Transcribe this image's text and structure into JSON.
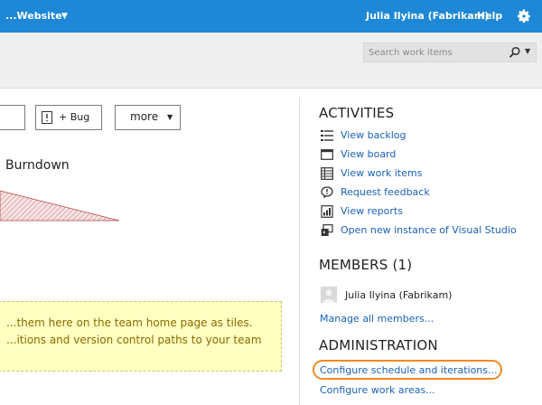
{
  "topbar": {
    "project": "...Website",
    "user": "Julia Ilyina (Fabrikam)",
    "help": "Help",
    "settings_icon": "gear-icon"
  },
  "search": {
    "placeholder": "Search work items"
  },
  "toolbar": {
    "bug_label": "+ Bug",
    "more_label": "more"
  },
  "burndown": {
    "title": "Burndown"
  },
  "tile_notice": {
    "line1": "...them here on the team home page as tiles.",
    "line2": "...itions and version control paths to your team"
  },
  "activities": {
    "title": "ACTIVITIES",
    "items": [
      {
        "label": "View backlog",
        "icon": "backlog-list-icon"
      },
      {
        "label": "View board",
        "icon": "board-icon"
      },
      {
        "label": "View work items",
        "icon": "work-items-icon"
      },
      {
        "label": "Request feedback",
        "icon": "feedback-icon"
      },
      {
        "label": "View reports",
        "icon": "reports-icon"
      },
      {
        "label": "Open new instance of Visual Studio",
        "icon": "visual-studio-icon"
      }
    ]
  },
  "members": {
    "title": "MEMBERS (1)",
    "list": [
      {
        "name": "Julia Ilyina (Fabrikam)"
      }
    ],
    "manage_link": "Manage all members..."
  },
  "administration": {
    "title": "ADMINISTRATION",
    "configure_schedule": "Configure schedule and iterations...",
    "configure_work_areas": "Configure work areas..."
  },
  "colors": {
    "topbar": "#1e88d6",
    "link": "#1a62b8",
    "highlight": "#f08a24",
    "tile_bg": "#ffffc2"
  }
}
